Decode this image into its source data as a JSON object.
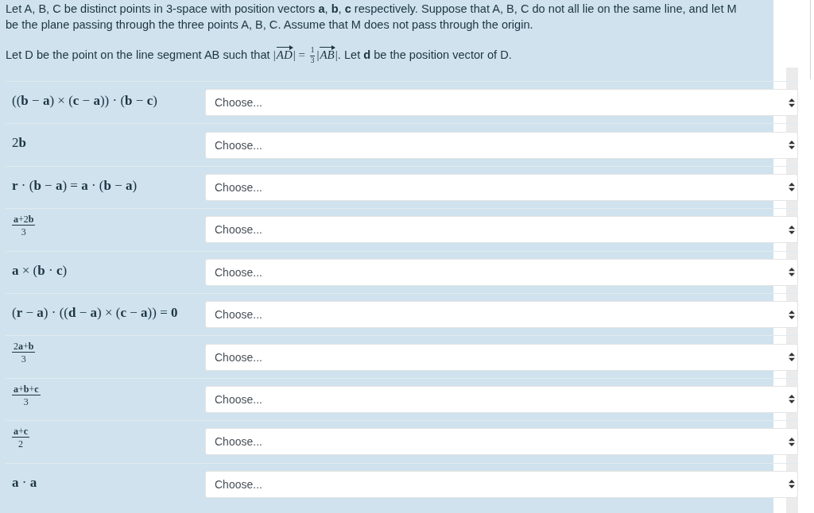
{
  "question": {
    "paragraphs": [
      {
        "parts": [
          {
            "kind": "text",
            "text": "Let A, B, C be distinct points in 3-space with position vectors **a**, **b**, **c** respectively. Suppose that A, B, C do not all lie on the same line, and let M be the plane passing through the three points A, B, C. Assume that M does not pass through the origin."
          }
        ]
      },
      {
        "parts": [
          {
            "kind": "text",
            "text": "Let D be the point on the line segment AB such that "
          },
          {
            "kind": "math",
            "text": "|"
          },
          {
            "kind": "vector",
            "text": "AD"
          },
          {
            "kind": "math",
            "text": "| = "
          },
          {
            "kind": "fraction",
            "numerator": "1",
            "denominator": "3"
          },
          {
            "kind": "math",
            "text": "|"
          },
          {
            "kind": "vector",
            "text": "AB"
          },
          {
            "kind": "math",
            "text": "|"
          },
          {
            "kind": "text",
            "text": ". Let **d** be the position vector of D."
          }
        ]
      }
    ]
  },
  "matches": [
    {
      "expression": {
        "kind": "inline",
        "text": "((**b** − **a**) × (**c** − **a**)) · (**b** − **c**)"
      },
      "choice": "Choose..."
    },
    {
      "expression": {
        "kind": "inline",
        "text": "2**b**"
      },
      "choice": "Choose..."
    },
    {
      "expression": {
        "kind": "inline",
        "text": "**r** · (**b** − **a**) = **a** · (**b** − **a**)"
      },
      "choice": "Choose..."
    },
    {
      "expression": {
        "kind": "fraction",
        "numerator": "**a**+2**b**",
        "denominator": "3"
      },
      "choice": "Choose..."
    },
    {
      "expression": {
        "kind": "inline",
        "text": "**a** × (**b** · **c**)"
      },
      "choice": "Choose..."
    },
    {
      "expression": {
        "kind": "inline",
        "text": "(**r** − **a**) · ((**d** − **a**) × (**c** − **a**)) = **0**"
      },
      "choice": "Choose..."
    },
    {
      "expression": {
        "kind": "fraction",
        "numerator": "2**a**+**b**",
        "denominator": "3"
      },
      "choice": "Choose..."
    },
    {
      "expression": {
        "kind": "fraction",
        "numerator": "**a**+**b**+**c**",
        "denominator": "3"
      },
      "choice": "Choose..."
    },
    {
      "expression": {
        "kind": "fraction",
        "numerator": "**a**+**c**",
        "denominator": "2"
      },
      "choice": "Choose..."
    },
    {
      "expression": {
        "kind": "inline",
        "text": "**a** · **a**"
      },
      "choice": "Choose..."
    }
  ]
}
